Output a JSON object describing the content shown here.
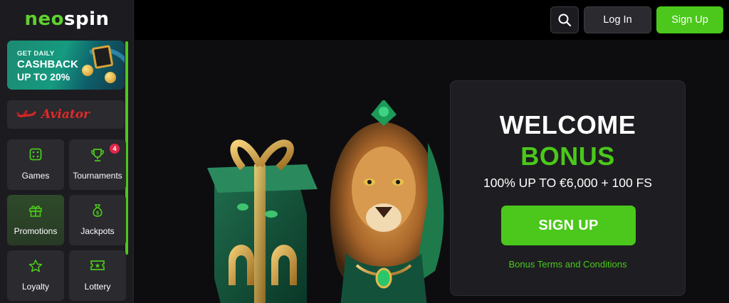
{
  "brand": {
    "logo_part1": "neo",
    "logo_part2": "spin",
    "accent": "#4bc81b"
  },
  "sidebar": {
    "promo": {
      "line1": "GET DAILY",
      "line2": "CASHBACK",
      "line3": "UP TO 20%"
    },
    "aviator": {
      "label": "Aviator"
    },
    "items": [
      {
        "label": "Games",
        "icon": "dice-icon"
      },
      {
        "label": "Tournaments",
        "icon": "trophy-icon",
        "badge": "4"
      },
      {
        "label": "Promotions",
        "icon": "gift-icon",
        "active": true
      },
      {
        "label": "Jackpots",
        "icon": "money-bag-icon"
      },
      {
        "label": "Loyalty",
        "icon": "star-icon"
      },
      {
        "label": "Lottery",
        "icon": "ticket-icon"
      }
    ]
  },
  "header": {
    "login_label": "Log In",
    "signup_label": "Sign Up",
    "search_icon": "search-icon"
  },
  "hero": {
    "title_line1": "WELCOME",
    "title_line2": "BONUS",
    "offer": "100% UP TO €6,000 + 100 FS",
    "cta_label": "SIGN UP",
    "terms_link": "Bonus Terms and Conditions"
  }
}
